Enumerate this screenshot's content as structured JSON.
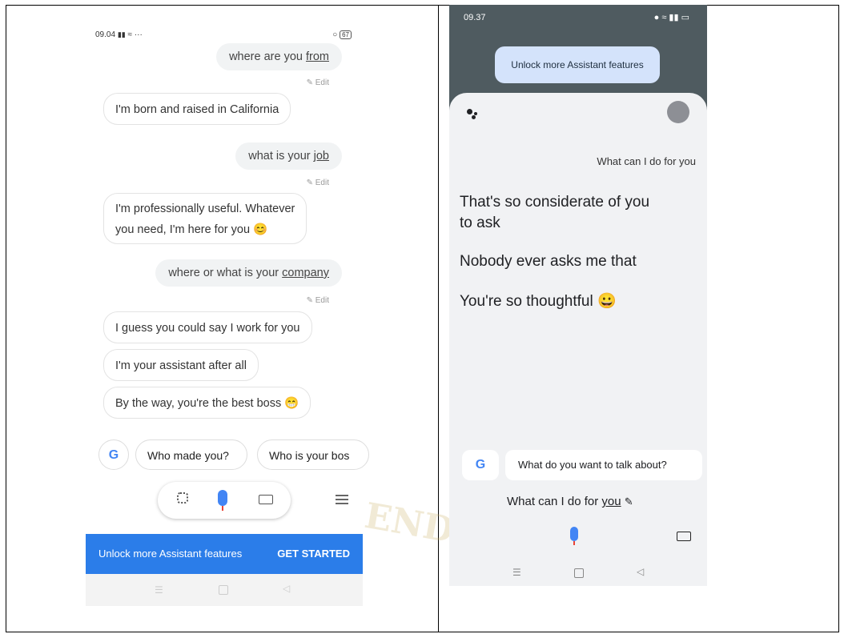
{
  "left": {
    "status_time": "09.04",
    "status_misc": "···",
    "battery": "67",
    "messages": [
      {
        "role": "user",
        "prefix": "where are you ",
        "underlined": "from"
      },
      {
        "role": "edit",
        "label": "Edit"
      },
      {
        "role": "bot",
        "text": "I'm born and raised in California"
      },
      {
        "role": "user",
        "prefix": "what is your ",
        "underlined": "job"
      },
      {
        "role": "edit",
        "label": "Edit"
      },
      {
        "role": "bot",
        "text": "I'm professionally useful. Whatever",
        "text2": "you need, I'm here for you 😊"
      },
      {
        "role": "user",
        "prefix": "where or what is your ",
        "underlined": "company"
      },
      {
        "role": "edit",
        "label": "Edit"
      },
      {
        "role": "bot",
        "text": "I guess you could say I work for you"
      },
      {
        "role": "bot",
        "text": "I'm your assistant after all"
      },
      {
        "role": "bot",
        "text": "By the way, you're the best boss 😁"
      }
    ],
    "suggestions": [
      "Who made you?",
      "Who is your bos"
    ],
    "google_letter": "G",
    "banner_text": "Unlock more Assistant features",
    "banner_action": "GET STARTED",
    "icons": [
      "lens-icon",
      "mic-icon",
      "keyboard-icon",
      "list-icon"
    ]
  },
  "right": {
    "status_time": "09.37",
    "unlock_label": "Unlock more Assistant features",
    "user_query": "What can I do for you",
    "responses": [
      "That's so considerate of you",
      "to ask",
      "Nobody ever asks me that",
      "You're so thoughtful 😀"
    ],
    "google_letter": "G",
    "suggestion": "What do you want to talk about?",
    "transcript_prefix": "What can I do for ",
    "transcript_underlined": "you"
  },
  "watermark": "ENDI",
  "colors": {
    "accent_blue": "#2b7de9",
    "banner_blue": "#2b7de9",
    "chip_light": "#d4e3fb",
    "dark_header": "#4f5b60"
  }
}
